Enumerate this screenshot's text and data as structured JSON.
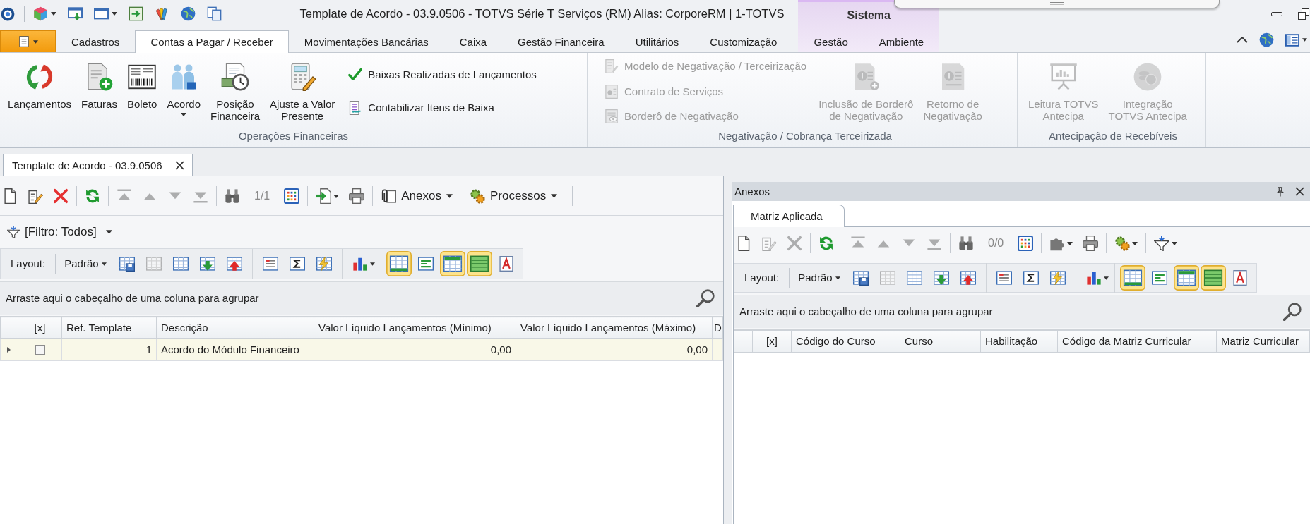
{
  "window_header": {
    "title": "Template de Acordo - 03.9.0506 - TOTVS Série T Serviços (RM) Alias: CorporeRM | 1-TOTVS"
  },
  "ribbon_tabs": [
    {
      "label": "Cadastros",
      "selected": false
    },
    {
      "label": "Contas a Pagar / Receber",
      "selected": true
    },
    {
      "label": "Movimentações Bancárias",
      "selected": false
    },
    {
      "label": "Caixa",
      "selected": false
    },
    {
      "label": "Gestão Financeira",
      "selected": false
    },
    {
      "label": "Utilitários",
      "selected": false
    },
    {
      "label": "Customização",
      "selected": false
    }
  ],
  "contextual_group": {
    "title": "Sistema",
    "tabs": [
      {
        "label": "Gestão",
        "selected": false
      },
      {
        "label": "Ambiente",
        "selected": false
      }
    ]
  },
  "ribbon_groups": [
    {
      "title": "Operações Financeiras",
      "buttons": [
        {
          "kind": "large",
          "label": "Lançamentos",
          "disabled": false
        },
        {
          "kind": "large",
          "label": "Faturas",
          "disabled": false
        },
        {
          "kind": "large",
          "label": "Boleto",
          "disabled": false
        },
        {
          "kind": "large",
          "label": "Acordo",
          "disabled": false,
          "dropdown": true
        },
        {
          "kind": "large",
          "label": "Posição\nFinanceira",
          "disabled": false
        },
        {
          "kind": "large",
          "label": "Ajuste a Valor\nPresente",
          "disabled": false
        },
        {
          "kind": "small",
          "label": "Baixas Realizadas de Lançamentos",
          "disabled": false
        },
        {
          "kind": "small",
          "label": "Contabilizar Itens de Baixa",
          "disabled": false
        }
      ]
    },
    {
      "title": "Negativação / Cobrança Terceirizada",
      "buttons": [
        {
          "kind": "small",
          "label": "Modelo de Negativação / Terceirização",
          "disabled": true
        },
        {
          "kind": "small",
          "label": "Contrato de Serviços",
          "disabled": true
        },
        {
          "kind": "small",
          "label": "Borderô de Negativação",
          "disabled": true
        },
        {
          "kind": "large",
          "label": "Inclusão de Borderô\nde Negativação",
          "disabled": true
        },
        {
          "kind": "large",
          "label": "Retorno de\nNegativação",
          "disabled": true
        }
      ]
    },
    {
      "title": "Antecipação de Recebíveis",
      "buttons": [
        {
          "kind": "large",
          "label": "Leitura TOTVS\nAntecipa",
          "disabled": true
        },
        {
          "kind": "large",
          "label": "Integração\nTOTVS Antecipa",
          "disabled": true
        }
      ]
    }
  ],
  "document_tabs": [
    {
      "label": "Template de Acordo - 03.9.0506",
      "selected": true
    }
  ],
  "left_panel": {
    "toolbar": {
      "tools": [
        {
          "disabled": false
        },
        {
          "disabled": false
        },
        {
          "disabled": false
        },
        {
          "disabled": false
        },
        {
          "disabled": true
        },
        {
          "disabled": true
        },
        {
          "disabled": true
        },
        {
          "disabled": true
        },
        {
          "disabled": false
        },
        {
          "disabled": false
        },
        {
          "disabled": false
        },
        {
          "disabled": false
        }
      ],
      "counter": "1/1",
      "buttons": [
        {
          "label": "Anexos"
        },
        {
          "label": "Processos"
        }
      ]
    },
    "filter": "[Filtro: Todos]",
    "layout_toolbar": {
      "label": "Layout:",
      "preset": "Padrão",
      "tools": [
        {
          "checked": false,
          "disabled": false
        },
        {
          "checked": false,
          "disabled": true
        },
        {
          "checked": false,
          "disabled": false
        },
        {
          "checked": false,
          "disabled": false
        },
        {
          "checked": false,
          "disabled": false
        },
        {
          "checked": false,
          "disabled": false
        },
        {
          "checked": false,
          "disabled": false
        },
        {
          "checked": false,
          "disabled": false
        },
        {
          "checked": false,
          "disabled": false
        },
        {
          "checked": true,
          "disabled": false
        },
        {
          "checked": false,
          "disabled": false
        },
        {
          "checked": true,
          "disabled": false
        },
        {
          "checked": true,
          "disabled": false
        },
        {
          "checked": false,
          "disabled": false
        }
      ]
    },
    "group_panel": "Arraste aqui o cabeçalho de uma coluna para agrupar",
    "table": {
      "columns": [
        "[x]",
        "Ref. Template",
        "Descrição",
        "Valor Líquido Lançamentos (Mínimo)",
        "Valor Líquido Lançamentos (Máximo)",
        "D"
      ],
      "rows": [
        {
          "selected": true,
          "checked": false,
          "cells": [
            "",
            "1",
            "Acordo do Módulo Financeiro",
            "0,00",
            "0,00"
          ]
        }
      ]
    }
  },
  "right_panel": {
    "title": "Anexos",
    "tabs": [
      {
        "label": "Matriz Aplicada",
        "selected": true
      }
    ],
    "toolbar": {
      "tools": [
        {
          "disabled": false
        },
        {
          "disabled": true
        },
        {
          "disabled": true
        },
        {
          "disabled": false
        },
        {
          "disabled": true
        },
        {
          "disabled": true
        },
        {
          "disabled": true
        },
        {
          "disabled": true
        },
        {
          "disabled": false
        },
        {
          "disabled": false
        },
        {
          "disabled": false
        },
        {
          "disabled": false
        },
        {
          "disabled": false
        },
        {
          "disabled": false
        }
      ],
      "counter": "0/0"
    },
    "layout_toolbar": {
      "label": "Layout:",
      "preset": "Padrão",
      "tools": [
        {
          "checked": false,
          "disabled": false
        },
        {
          "checked": false,
          "disabled": true
        },
        {
          "checked": false,
          "disabled": false
        },
        {
          "checked": false,
          "disabled": false
        },
        {
          "checked": false,
          "disabled": false
        },
        {
          "checked": false,
          "disabled": false
        },
        {
          "checked": false,
          "disabled": false
        },
        {
          "checked": false,
          "disabled": false
        },
        {
          "checked": false,
          "disabled": false
        },
        {
          "checked": true,
          "disabled": false
        },
        {
          "checked": false,
          "disabled": false
        },
        {
          "checked": true,
          "disabled": false
        },
        {
          "checked": true,
          "disabled": false
        },
        {
          "checked": false,
          "disabled": false
        }
      ]
    },
    "group_panel": "Arraste aqui o cabeçalho de uma coluna para agrupar",
    "table": {
      "columns": [
        "[x]",
        "Código do Curso",
        "Curso",
        "Habilitação",
        "Código da Matriz Curricular",
        "Matriz Curricular"
      ]
    }
  }
}
